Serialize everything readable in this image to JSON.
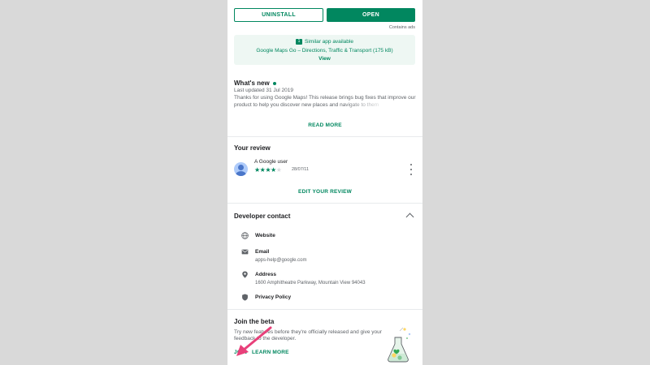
{
  "buttons": {
    "uninstall": "UNINSTALL",
    "open": "OPEN"
  },
  "contains_ads": "Contains ads",
  "similar_app": {
    "badge": "1",
    "title": "Similar app available",
    "app_name": "Google Maps Go – Directions, Traffic & Transport (175 kB)",
    "view_label": "View"
  },
  "whats_new": {
    "title": "What's new",
    "last_updated": "Last updated 31 Jul 2019",
    "body_line1": "Thanks for using Google Maps! This release brings bug fixes that improve our",
    "body_line2": "product to help you discover new places and navigate to them",
    "read_more": "READ MORE"
  },
  "your_review": {
    "title": "Your review",
    "user_name": "A Google user",
    "rating": 4,
    "date": "28/07/11",
    "edit_label": "EDIT YOUR REVIEW"
  },
  "developer_contact": {
    "title": "Developer contact",
    "items": [
      {
        "icon": "globe-icon",
        "label": "Website",
        "value": ""
      },
      {
        "icon": "email-icon",
        "label": "Email",
        "value": "apps-help@google.com"
      },
      {
        "icon": "location-pin-icon",
        "label": "Address",
        "value": "1600 Amphitheatre Parkway, Mountain View 94043"
      },
      {
        "icon": "shield-icon",
        "label": "Privacy Policy",
        "value": ""
      }
    ]
  },
  "join_beta": {
    "title": "Join the beta",
    "body_line1": "Try new features before they're officially released and give your",
    "body_line2": "feedback to the developer.",
    "join_label": "JOIN",
    "learn_more_label": "LEARN MORE"
  },
  "colors": {
    "accent": "#01875f",
    "annotation_arrow": "#e8407a",
    "background": "#d9d9d9",
    "card": "#ffffff"
  }
}
